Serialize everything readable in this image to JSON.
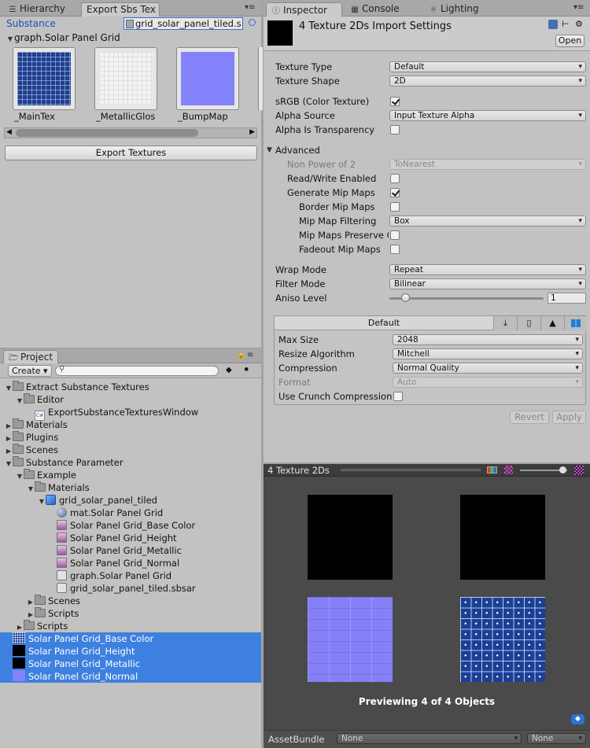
{
  "left_top": {
    "tabs": [
      "Hierarchy",
      "Export Sbs Tex"
    ],
    "substance_label": "Substance",
    "substance_field": "grid_solar_panel_tiled.s",
    "graph_title": "graph.Solar Panel Grid",
    "thumbs": [
      "_MainTex",
      "_MetallicGlos",
      "_BumpMap"
    ],
    "export_button": "Export Textures"
  },
  "project": {
    "tab": "Project",
    "create_label": "Create",
    "search_placeholder": "",
    "tree": [
      {
        "label": "Extract Substance Textures",
        "type": "folder",
        "depth": 0,
        "fold": "open"
      },
      {
        "label": "Editor",
        "type": "folder",
        "depth": 1,
        "fold": "open"
      },
      {
        "label": "ExportSubstanceTexturesWindow",
        "type": "script",
        "depth": 2,
        "fold": ""
      },
      {
        "label": "Materials",
        "type": "folder",
        "depth": 0,
        "fold": "closed"
      },
      {
        "label": "Plugins",
        "type": "folder",
        "depth": 0,
        "fold": "closed"
      },
      {
        "label": "Scenes",
        "type": "folder",
        "depth": 0,
        "fold": "closed"
      },
      {
        "label": "Substance Parameter",
        "type": "folder",
        "depth": 0,
        "fold": "open"
      },
      {
        "label": "Example",
        "type": "folder",
        "depth": 1,
        "fold": "open"
      },
      {
        "label": "Materials",
        "type": "folder",
        "depth": 2,
        "fold": "open"
      },
      {
        "label": "grid_solar_panel_tiled",
        "type": "substance",
        "depth": 3,
        "fold": "open"
      },
      {
        "label": "mat.Solar Panel Grid",
        "type": "material",
        "depth": 4,
        "fold": ""
      },
      {
        "label": "Solar Panel Grid_Base Color",
        "type": "texture",
        "depth": 4,
        "fold": ""
      },
      {
        "label": "Solar Panel Grid_Height",
        "type": "texture",
        "depth": 4,
        "fold": ""
      },
      {
        "label": "Solar Panel Grid_Metallic",
        "type": "texture",
        "depth": 4,
        "fold": ""
      },
      {
        "label": "Solar Panel Grid_Normal",
        "type": "texture",
        "depth": 4,
        "fold": ""
      },
      {
        "label": "graph.Solar Panel Grid",
        "type": "graph",
        "depth": 4,
        "fold": ""
      },
      {
        "label": "grid_solar_panel_tiled.sbsar",
        "type": "graph",
        "depth": 4,
        "fold": ""
      },
      {
        "label": "Scenes",
        "type": "folder",
        "depth": 2,
        "fold": "closed"
      },
      {
        "label": "Scripts",
        "type": "folder",
        "depth": 2,
        "fold": "closed"
      },
      {
        "label": "Scripts",
        "type": "folder",
        "depth": 1,
        "fold": "closed"
      },
      {
        "label": "Solar Panel Grid_Base Color",
        "type": "thumb-grid",
        "depth": 0,
        "fold": "",
        "selected": true
      },
      {
        "label": "Solar Panel Grid_Height",
        "type": "thumb-black",
        "depth": 0,
        "fold": "",
        "selected": true
      },
      {
        "label": "Solar Panel Grid_Metallic",
        "type": "thumb-black",
        "depth": 0,
        "fold": "",
        "selected": true
      },
      {
        "label": "Solar Panel Grid_Normal",
        "type": "thumb-normal",
        "depth": 0,
        "fold": "",
        "selected": true
      }
    ]
  },
  "inspector": {
    "tabs": [
      "Inspector",
      "Console",
      "Lighting"
    ],
    "title": "4 Texture 2Ds Import Settings",
    "open_button": "Open",
    "texture_type": {
      "label": "Texture Type",
      "value": "Default"
    },
    "texture_shape": {
      "label": "Texture Shape",
      "value": "2D"
    },
    "srgb": {
      "label": "sRGB (Color Texture)",
      "checked": true
    },
    "alpha_source": {
      "label": "Alpha Source",
      "value": "Input Texture Alpha"
    },
    "alpha_transparency": {
      "label": "Alpha Is Transparency",
      "checked": false
    },
    "advanced": "Advanced",
    "non_power": {
      "label": "Non Power of 2",
      "value": "ToNearest"
    },
    "read_write": {
      "label": "Read/Write Enabled",
      "checked": false
    },
    "gen_mips": {
      "label": "Generate Mip Maps",
      "checked": true
    },
    "border_mips": {
      "label": "Border Mip Maps",
      "checked": false
    },
    "mip_filter": {
      "label": "Mip Map Filtering",
      "value": "Box"
    },
    "mip_preserve": {
      "label": "Mip Maps Preserve C",
      "checked": false
    },
    "fadeout": {
      "label": "Fadeout Mip Maps",
      "checked": false
    },
    "wrap": {
      "label": "Wrap Mode",
      "value": "Repeat"
    },
    "filter": {
      "label": "Filter Mode",
      "value": "Bilinear"
    },
    "aniso": {
      "label": "Aniso Level",
      "value": "1",
      "slider_fraction": 0.1
    },
    "platform_tab": "Default",
    "max_size": {
      "label": "Max Size",
      "value": "2048"
    },
    "resize": {
      "label": "Resize Algorithm",
      "value": "Mitchell"
    },
    "compression": {
      "label": "Compression",
      "value": "Normal Quality"
    },
    "format": {
      "label": "Format",
      "value": "Auto"
    },
    "crunch": {
      "label": "Use Crunch Compression",
      "checked": false
    },
    "revert": "Revert",
    "apply": "Apply"
  },
  "preview": {
    "title": "4 Texture 2Ds",
    "status": "Previewing 4 of 4 Objects",
    "asset_bundle_label": "AssetBundle",
    "bundle_value": "None",
    "variant_value": "None",
    "zoom_fraction": 0.9
  },
  "colors": {
    "selection": "#3d80df",
    "normal_map": "#8080ff",
    "panel_blue": "#1d3f8f"
  }
}
